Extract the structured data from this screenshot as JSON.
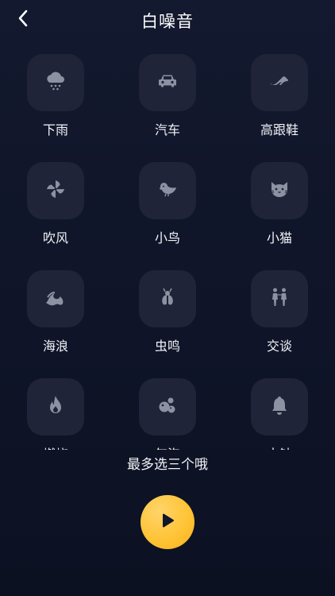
{
  "header": {
    "title": "白噪音",
    "back_icon": "chevron-left-icon"
  },
  "sounds": [
    {
      "label": "下雨",
      "icon": "rain-cloud-icon"
    },
    {
      "label": "汽车",
      "icon": "car-icon"
    },
    {
      "label": "高跟鞋",
      "icon": "high-heel-icon"
    },
    {
      "label": "吹风",
      "icon": "pinwheel-icon"
    },
    {
      "label": "小鸟",
      "icon": "bird-icon"
    },
    {
      "label": "小猫",
      "icon": "cat-icon"
    },
    {
      "label": "海浪",
      "icon": "wave-icon"
    },
    {
      "label": "虫鸣",
      "icon": "cicada-icon"
    },
    {
      "label": "交谈",
      "icon": "people-icon"
    },
    {
      "label": "燃烧",
      "icon": "flame-icon"
    },
    {
      "label": "气泡",
      "icon": "bubbles-icon"
    },
    {
      "label": "古钟",
      "icon": "bell-icon"
    }
  ],
  "hint": "最多选三个哦",
  "play_icon": "play-icon",
  "colors": {
    "accent": "#ffc437",
    "tile": "#1f2438",
    "background": "#11172b",
    "icon": "#8d92a3"
  }
}
